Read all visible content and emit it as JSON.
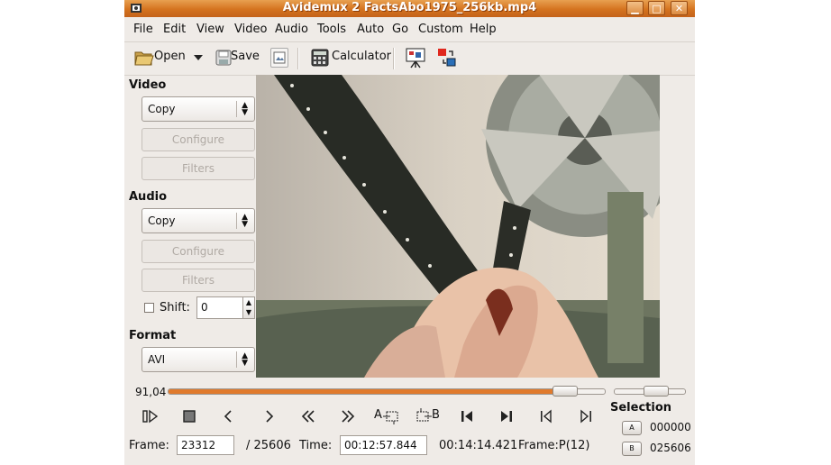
{
  "window": {
    "title": "Avidemux 2 FactsAbo1975_256kb.mp4"
  },
  "menu": [
    "File",
    "Edit",
    "View",
    "Video",
    "Audio",
    "Tools",
    "Auto",
    "Go",
    "Custom",
    "Help"
  ],
  "toolbar": {
    "open": "Open",
    "save": "Save",
    "calculator": "Calculator"
  },
  "video": {
    "label": "Video",
    "codec": "Copy",
    "configure": "Configure",
    "filters": "Filters"
  },
  "audio": {
    "label": "Audio",
    "codec": "Copy",
    "configure": "Configure",
    "filters": "Filters",
    "shift_label": "Shift:",
    "shift_value": "0",
    "shift_checked": false
  },
  "format": {
    "label": "Format",
    "value": "AVI"
  },
  "timeline": {
    "position_label": "91,04",
    "position": 0.9104,
    "volume": 0.6
  },
  "selection": {
    "label": "Selection",
    "a_button": "A",
    "a_value": "000000",
    "b_button": "B",
    "b_value": "025606"
  },
  "markers": {
    "a": "A",
    "b": "B"
  },
  "status": {
    "frame_label": "Frame:",
    "frame_value": "23312",
    "frame_total": "/ 25606",
    "time_label": "Time:",
    "time_value": "00:12:57.844",
    "duration": "00:14:14.421",
    "frame_type": "Frame:P(12)"
  },
  "icons": [
    "avidemux-icon",
    "minimize-icon",
    "maximize-icon",
    "close-icon",
    "open-folder-icon",
    "dropdown-arrow-icon",
    "save-disk-icon",
    "save-image-icon",
    "calculator-icon",
    "preview-display-icon",
    "swap-output-icon",
    "play-icon",
    "stop-icon",
    "previous-frame-icon",
    "next-frame-icon",
    "rewind-icon",
    "fast-forward-icon",
    "set-marker-a-icon",
    "set-marker-b-icon",
    "go-to-start-icon",
    "go-to-end-icon",
    "previous-keyframe-icon",
    "next-keyframe-icon"
  ]
}
